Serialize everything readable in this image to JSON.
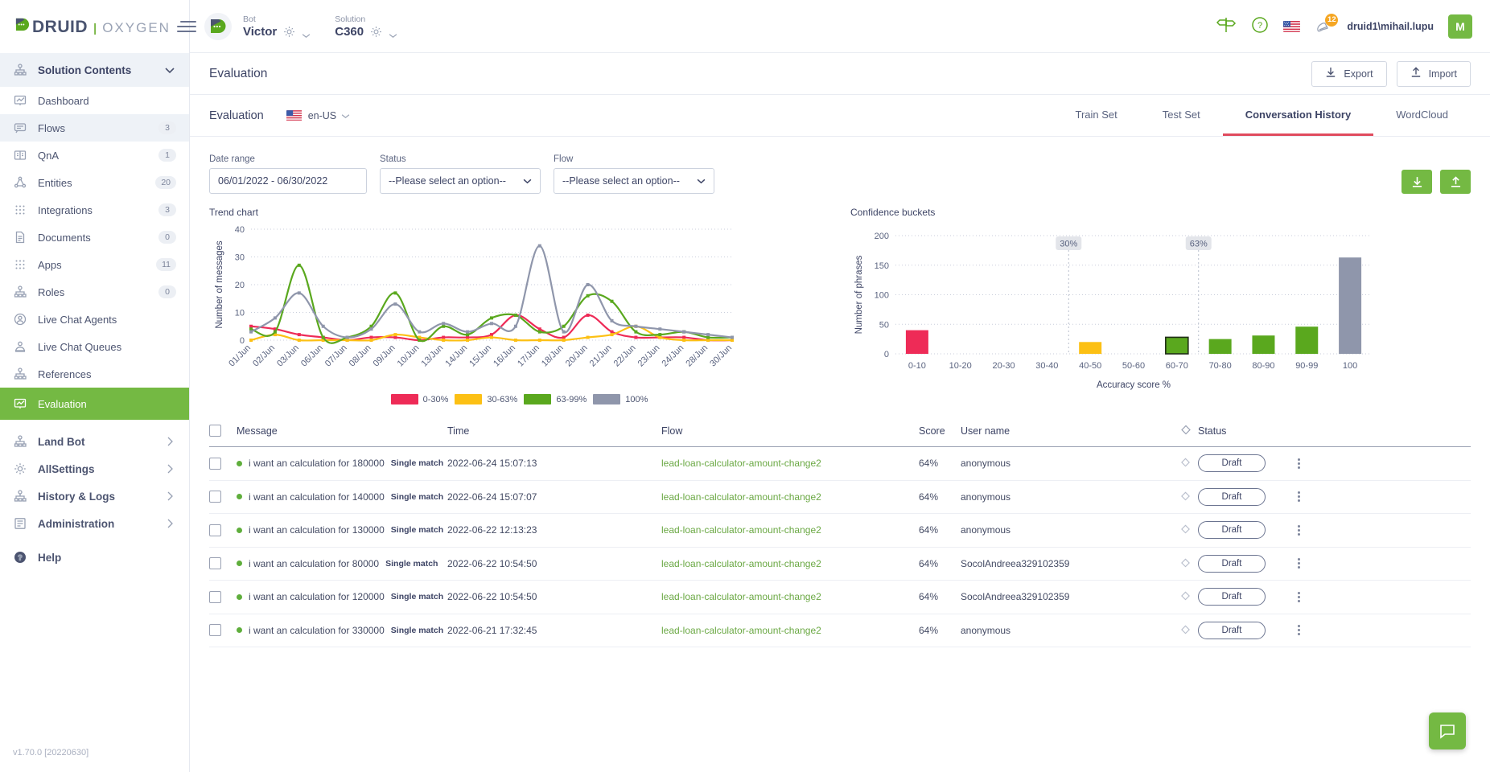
{
  "brand": {
    "name": "DRUID",
    "separator": "|",
    "product": "OXYGEN"
  },
  "header": {
    "bot_label": "Bot",
    "bot_value": "Victor",
    "solution_label": "Solution",
    "solution_value": "C360",
    "notifications_count": "12",
    "user_name": "druid1\\mihail.lupu",
    "user_initial": "M",
    "locale_flag": "us-flag"
  },
  "sidebar": {
    "section_title": "Solution Contents",
    "items": [
      {
        "label": "Dashboard",
        "badge": "",
        "icon": "dashboard-icon",
        "state": ""
      },
      {
        "label": "Flows",
        "badge": "3",
        "icon": "flows-icon",
        "state": "sel-soft"
      },
      {
        "label": "QnA",
        "badge": "1",
        "icon": "qna-icon",
        "state": ""
      },
      {
        "label": "Entities",
        "badge": "20",
        "icon": "entities-icon",
        "state": ""
      },
      {
        "label": "Integrations",
        "badge": "3",
        "icon": "integrations-icon",
        "state": ""
      },
      {
        "label": "Documents",
        "badge": "0",
        "icon": "documents-icon",
        "state": ""
      },
      {
        "label": "Apps",
        "badge": "11",
        "icon": "apps-icon",
        "state": ""
      },
      {
        "label": "Roles",
        "badge": "0",
        "icon": "roles-icon",
        "state": ""
      },
      {
        "label": "Live Chat Agents",
        "badge": "",
        "icon": "agent-icon",
        "state": ""
      },
      {
        "label": "Live Chat Queues",
        "badge": "",
        "icon": "queue-icon",
        "state": ""
      },
      {
        "label": "References",
        "badge": "",
        "icon": "references-icon",
        "state": ""
      },
      {
        "label": "Evaluation",
        "badge": "",
        "icon": "evaluation-icon",
        "state": "active"
      }
    ],
    "groups": [
      {
        "label": "Land Bot",
        "icon": "landbot-icon"
      },
      {
        "label": "AllSettings",
        "icon": "gear-icon"
      },
      {
        "label": "History & Logs",
        "icon": "history-icon"
      },
      {
        "label": "Administration",
        "icon": "administration-icon"
      }
    ],
    "help": {
      "label": "Help",
      "icon": "help-icon"
    },
    "version": "v1.70.0 [20220630]"
  },
  "page": {
    "title": "Evaluation",
    "export_label": "Export",
    "import_label": "Import"
  },
  "tabs": {
    "section_title": "Evaluation",
    "language": "en-US",
    "items": [
      {
        "label": "Train Set",
        "active": false
      },
      {
        "label": "Test Set",
        "active": false
      },
      {
        "label": "Conversation History",
        "active": true
      },
      {
        "label": "WordCloud",
        "active": false
      }
    ]
  },
  "filters": {
    "date_range_label": "Date range",
    "date_range_value": "06/01/2022 - 06/30/2022",
    "status_label": "Status",
    "status_value": "--Please select an option--",
    "flow_label": "Flow",
    "flow_value": "--Please select an option--"
  },
  "chart_data": [
    {
      "type": "line",
      "title": "Trend chart",
      "xlabel": "",
      "ylabel": "Number of messages",
      "ylim": [
        0,
        40
      ],
      "yticks": [
        0,
        10,
        20,
        30,
        40
      ],
      "grid": true,
      "legend_position": "bottom",
      "categories": [
        "01/Jun",
        "02/Jun",
        "03/Jun",
        "06/Jun",
        "07/Jun",
        "08/Jun",
        "09/Jun",
        "10/Jun",
        "13/Jun",
        "14/Jun",
        "15/Jun",
        "16/Jun",
        "17/Jun",
        "18/Jun",
        "20/Jun",
        "21/Jun",
        "22/Jun",
        "23/Jun",
        "24/Jun",
        "28/Jun",
        "30/Jun"
      ],
      "series": [
        {
          "name": "0-30%",
          "color": "#ee2b57",
          "values": [
            5,
            4,
            2,
            1,
            0,
            1,
            1,
            0,
            1,
            1,
            2,
            9,
            4,
            1,
            9,
            3,
            1,
            1,
            1,
            0,
            0
          ]
        },
        {
          "name": "30-63%",
          "color": "#fcc014",
          "values": [
            0,
            2,
            0,
            0,
            0,
            0,
            2,
            1,
            0,
            0,
            1,
            0,
            0,
            0,
            1,
            2,
            5,
            1,
            0,
            0,
            0
          ]
        },
        {
          "name": "63-99%",
          "color": "#5aa81e",
          "values": [
            4,
            3,
            27,
            1,
            1,
            5,
            17,
            0,
            5,
            2,
            8,
            9,
            3,
            5,
            16,
            14,
            3,
            2,
            3,
            1,
            1
          ]
        },
        {
          "name": "100%",
          "color": "#8f96ab",
          "values": [
            3,
            8,
            17,
            5,
            1,
            4,
            13,
            3,
            6,
            3,
            6,
            5,
            34,
            3,
            20,
            7,
            5,
            4,
            3,
            2,
            1
          ]
        }
      ]
    },
    {
      "type": "bar",
      "title": "Confidence buckets",
      "xlabel": "Accuracy score %",
      "ylabel": "Number of phrases",
      "ylim": [
        0,
        200
      ],
      "yticks": [
        0,
        50,
        100,
        150,
        200
      ],
      "grid": true,
      "categories": [
        "0-10",
        "10-20",
        "20-30",
        "30-40",
        "40-50",
        "50-60",
        "60-70",
        "70-80",
        "80-90",
        "90-99",
        "100"
      ],
      "values": [
        40,
        0,
        0,
        0,
        20,
        0,
        28,
        25,
        31,
        46,
        163
      ],
      "colors": [
        "#ee2b57",
        "#ee2b57",
        "#ee2b57",
        "#fcc014",
        "#fcc014",
        "#fcc014",
        "#5aa81e",
        "#5aa81e",
        "#5aa81e",
        "#5aa81e",
        "#8f96ab"
      ],
      "markers": [
        {
          "label": "30%",
          "category_index": 3.5
        },
        {
          "label": "63%",
          "category_index": 6.5
        }
      ]
    }
  ],
  "table": {
    "columns": [
      "Message",
      "Time",
      "Flow",
      "Score",
      "User name",
      "",
      "Status"
    ],
    "rows": [
      {
        "message": "i want an calculation for 180000",
        "match": "Single match",
        "time": "2022-06-24 15:07:13",
        "flow": "lead-loan-calculator-amount-change2",
        "score": "64%",
        "user": "anonymous",
        "status": "Draft"
      },
      {
        "message": "i want an calculation for 140000",
        "match": "Single match",
        "time": "2022-06-24 15:07:07",
        "flow": "lead-loan-calculator-amount-change2",
        "score": "64%",
        "user": "anonymous",
        "status": "Draft"
      },
      {
        "message": "i want an calculation for 130000",
        "match": "Single match",
        "time": "2022-06-22 12:13:23",
        "flow": "lead-loan-calculator-amount-change2",
        "score": "64%",
        "user": "anonymous",
        "status": "Draft"
      },
      {
        "message": "i want an calculation for 80000",
        "match": "Single match",
        "time": "2022-06-22 10:54:50",
        "flow": "lead-loan-calculator-amount-change2",
        "score": "64%",
        "user": "SocolAndreea329102359",
        "status": "Draft"
      },
      {
        "message": "i want an calculation for 120000",
        "match": "Single match",
        "time": "2022-06-22 10:54:50",
        "flow": "lead-loan-calculator-amount-change2",
        "score": "64%",
        "user": "SocolAndreea329102359",
        "status": "Draft"
      },
      {
        "message": "i want an calculation for 330000",
        "match": "Single match",
        "time": "2022-06-21 17:32:45",
        "flow": "lead-loan-calculator-amount-change2",
        "score": "64%",
        "user": "anonymous",
        "status": "Draft"
      }
    ]
  },
  "colors": {
    "accent_green": "#74b943",
    "tab_underline": "#e04b5e",
    "red": "#ee2b57",
    "yellow": "#fcc014",
    "green": "#5aa81e",
    "grey": "#8f96ab"
  }
}
